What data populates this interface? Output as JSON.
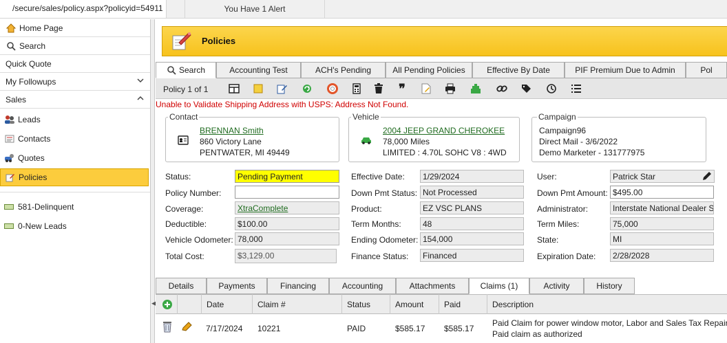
{
  "browser": {
    "url": "/secure/sales/policy.aspx?policyid=54911",
    "alert": "You Have 1 Alert"
  },
  "sidebar": {
    "items": [
      {
        "label": "Home Page",
        "icon": "home-icon"
      },
      {
        "label": "Search",
        "icon": "search-icon"
      },
      {
        "label": "Quick Quote"
      },
      {
        "label": "My Followups"
      },
      {
        "label": "Sales"
      }
    ],
    "sales_items": [
      {
        "label": "Leads",
        "icon": "leads-icon"
      },
      {
        "label": "Contacts",
        "icon": "contacts-icon"
      },
      {
        "label": "Quotes",
        "icon": "quotes-icon"
      },
      {
        "label": "Policies",
        "icon": "policies-icon"
      }
    ],
    "reports": [
      {
        "label": "581-Delinquent"
      },
      {
        "label": "0-New Leads"
      }
    ]
  },
  "header": {
    "title": "Policies"
  },
  "tabs": [
    "Search",
    "Accounting Test",
    "ACH's Pending",
    "All Pending Policies",
    "Effective By Date",
    "PIF Premium Due to Admin",
    "Pol"
  ],
  "toolbar": {
    "record_position": "Policy 1 of 1"
  },
  "error": "Unable to Validate Shipping Address with USPS: Address Not Found.",
  "contact": {
    "title": "Contact",
    "name": "BRENNAN Smith",
    "street": "860 Victory Lane",
    "city": "PENTWATER, MI 49449"
  },
  "vehicle": {
    "title": "Vehicle",
    "name": "2004 JEEP GRAND CHEROKEE",
    "miles": "78,000 Miles",
    "trim": "LIMITED : 4.70L SOHC V8 : 4WD"
  },
  "campaign": {
    "title": "Campaign",
    "name": "Campaign96",
    "source": "Direct Mail - 3/6/2022",
    "marketer": "Demo Marketer - 131777975"
  },
  "form": {
    "status_label": "Status:",
    "status": "Pending Payment",
    "policy_number_label": "Policy Number:",
    "policy_number": "",
    "coverage_label": "Coverage:",
    "coverage": "XtraComplete",
    "deductible_label": "Deductible:",
    "deductible": "$100.00",
    "vehicle_odometer_label": "Vehicle Odometer:",
    "vehicle_odometer": "78,000",
    "total_cost_label": "Total Cost:",
    "total_cost": "$3,129.00",
    "effective_date_label": "Effective Date:",
    "effective_date": "1/29/2024",
    "down_pmt_status_label": "Down Pmt Status:",
    "down_pmt_status": "Not Processed",
    "product_label": "Product:",
    "product": "EZ VSC PLANS",
    "term_months_label": "Term Months:",
    "term_months": "48",
    "ending_odometer_label": "Ending Odometer:",
    "ending_odometer": "154,000",
    "finance_status_label": "Finance Status:",
    "finance_status": "Financed",
    "user_label": "User:",
    "user": "Patrick Star",
    "down_pmt_amount_label": "Down Pmt Amount:",
    "down_pmt_amount": "$495.00",
    "administrator_label": "Administrator:",
    "administrator": "Interstate National Dealer S",
    "term_miles_label": "Term Miles:",
    "term_miles": "75,000",
    "state_label": "State:",
    "state": "MI",
    "expiration_date_label": "Expiration Date:",
    "expiration_date": "2/28/2028"
  },
  "bottom_tabs": [
    "Details",
    "Payments",
    "Financing",
    "Accounting",
    "Attachments",
    "Claims (1)",
    "Activity",
    "History"
  ],
  "claims": {
    "columns": [
      "Date",
      "Claim #",
      "Status",
      "Amount",
      "Paid",
      "Description"
    ],
    "rows": [
      {
        "date": "7/17/2024",
        "claim": "10221",
        "status": "PAID",
        "amount": "$585.17",
        "paid": "$585.17",
        "description1": "Paid Claim for power window motor, Labor and Sales Tax Repair.",
        "description2": "Paid claim as authorized"
      }
    ]
  },
  "colors": {
    "accent": "#fccc3d",
    "error": "#d00000",
    "link": "#1f6b1f",
    "status_highlight": "#ffff00"
  }
}
